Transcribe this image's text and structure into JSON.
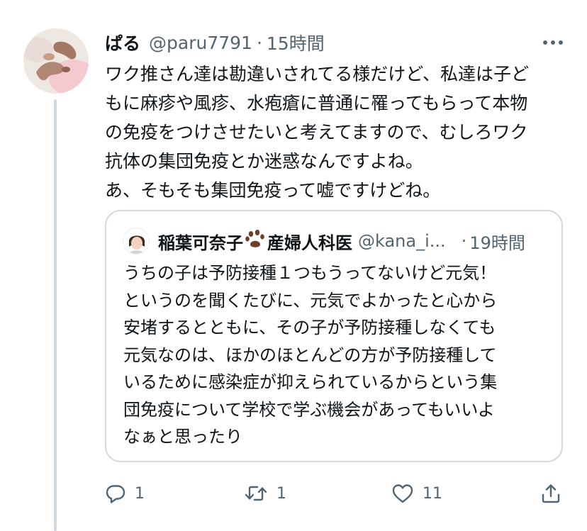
{
  "tweet": {
    "display_name": "ぱる",
    "handle": "@paru7791",
    "separator": "·",
    "time": "15時間",
    "lines": [
      "ワク推さん達は勘違いされてる様だけど、私達は子ど",
      "もに麻疹や風疹、水疱瘡に普通に罹ってもらって本物",
      "の免疫をつけさせたいと考えてますので、むしろワク",
      "抗体の集団免疫とか迷惑なんですよね。",
      "あ、そもそも集団免疫って嘘ですけどね。"
    ]
  },
  "quote": {
    "display_name": "稲葉可奈子",
    "display_name_suffix": "産婦人科医",
    "handle": "@kana_i...",
    "separator": "·",
    "time": "19時間",
    "lines": [
      "うちの子は予防接種１つもうってないけど元気！",
      "というのを聞くたびに、元気でよかったと心から",
      "安堵するとともに、その子が予防接種しなくても",
      "元気なのは、ほかのほとんどの方が予防接種して",
      "いるために感染症が抑えられているからという集",
      "団免疫について学校で学ぶ機会があってもいいよ",
      "なぁと思ったり"
    ]
  },
  "actions": {
    "reply_count": "1",
    "retweet_count": "1",
    "like_count": "11"
  },
  "icons": {
    "more": "more-dots-icon",
    "reply": "reply-icon",
    "retweet": "retweet-icon",
    "like": "heart-icon",
    "share": "share-icon",
    "paw": "paw-print-icon"
  },
  "colors": {
    "text": "#0f1419",
    "secondary": "#536471",
    "border": "#cfd9de",
    "paw": "#6b3f2a"
  }
}
